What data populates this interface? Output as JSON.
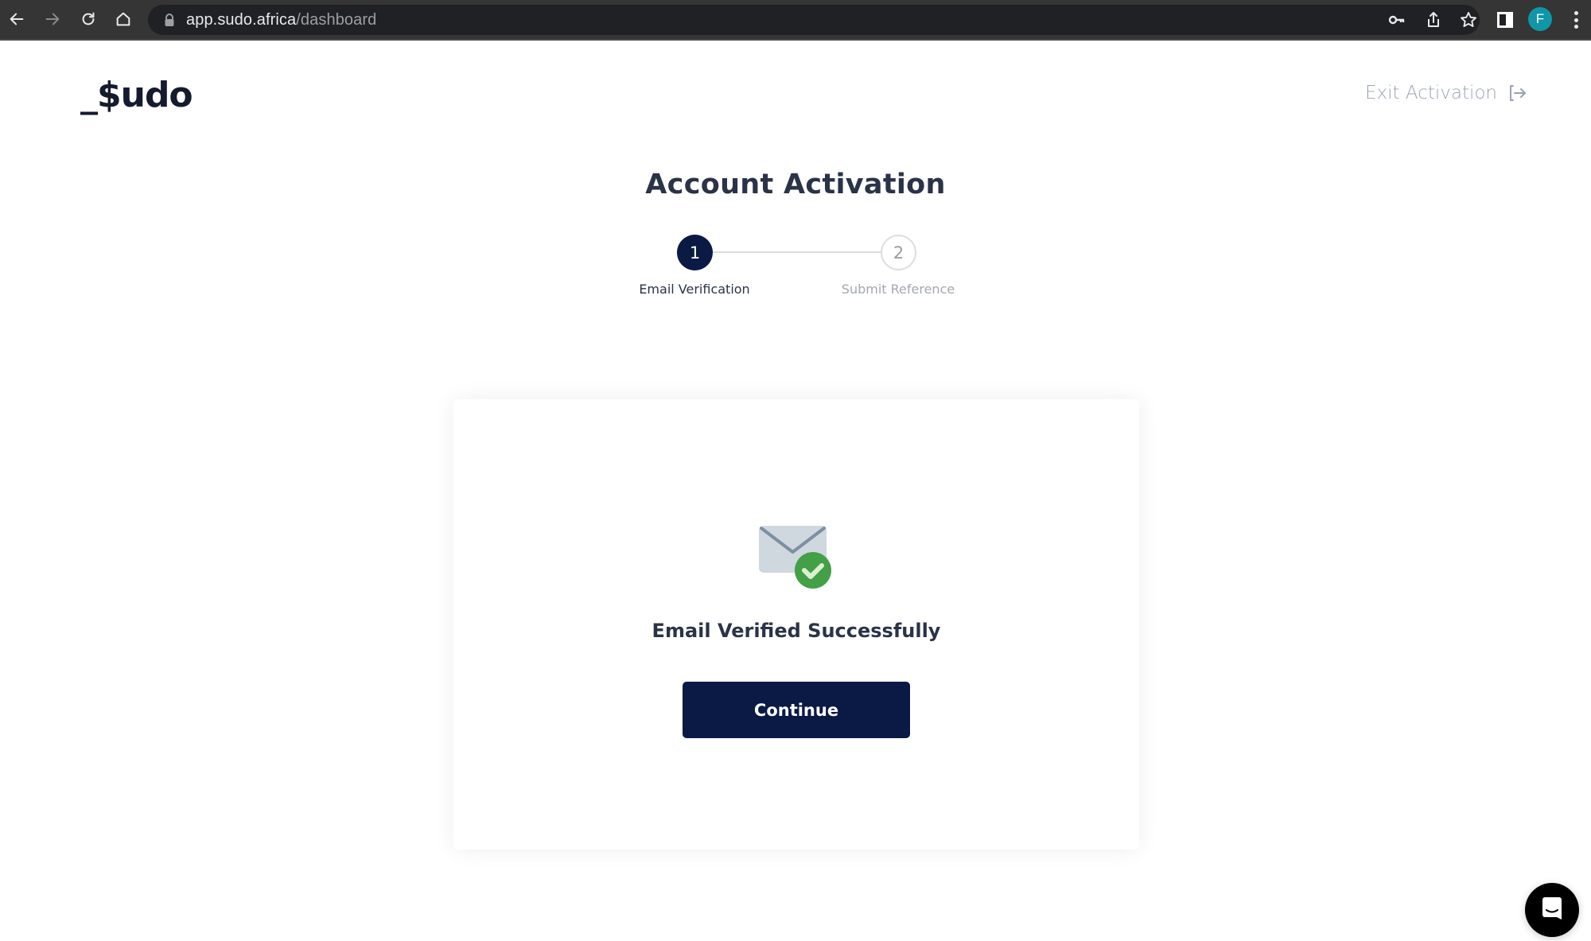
{
  "browser": {
    "url_host": "app.sudo.africa",
    "url_path": "/dashboard",
    "profile_initial": "F",
    "colors": {
      "avatar": "#0f97a8",
      "toolbar": "#353535",
      "urlbar": "#202124"
    }
  },
  "header": {
    "logo": "_$udo",
    "exit_label": "Exit Activation"
  },
  "page": {
    "title": "Account Activation"
  },
  "stepper": {
    "current_step": 1,
    "steps": [
      {
        "number": "1",
        "label": "Email Verification",
        "state": "active"
      },
      {
        "number": "2",
        "label": "Submit Reference",
        "state": "inactive"
      }
    ]
  },
  "card": {
    "status_icon": "email-verified-icon",
    "message": "Email Verified Successfully",
    "continue_label": "Continue"
  },
  "theme": {
    "primary": "#0b1a45",
    "text": "#2a3347",
    "muted": "#9aa3b5",
    "success": "#43a047"
  }
}
